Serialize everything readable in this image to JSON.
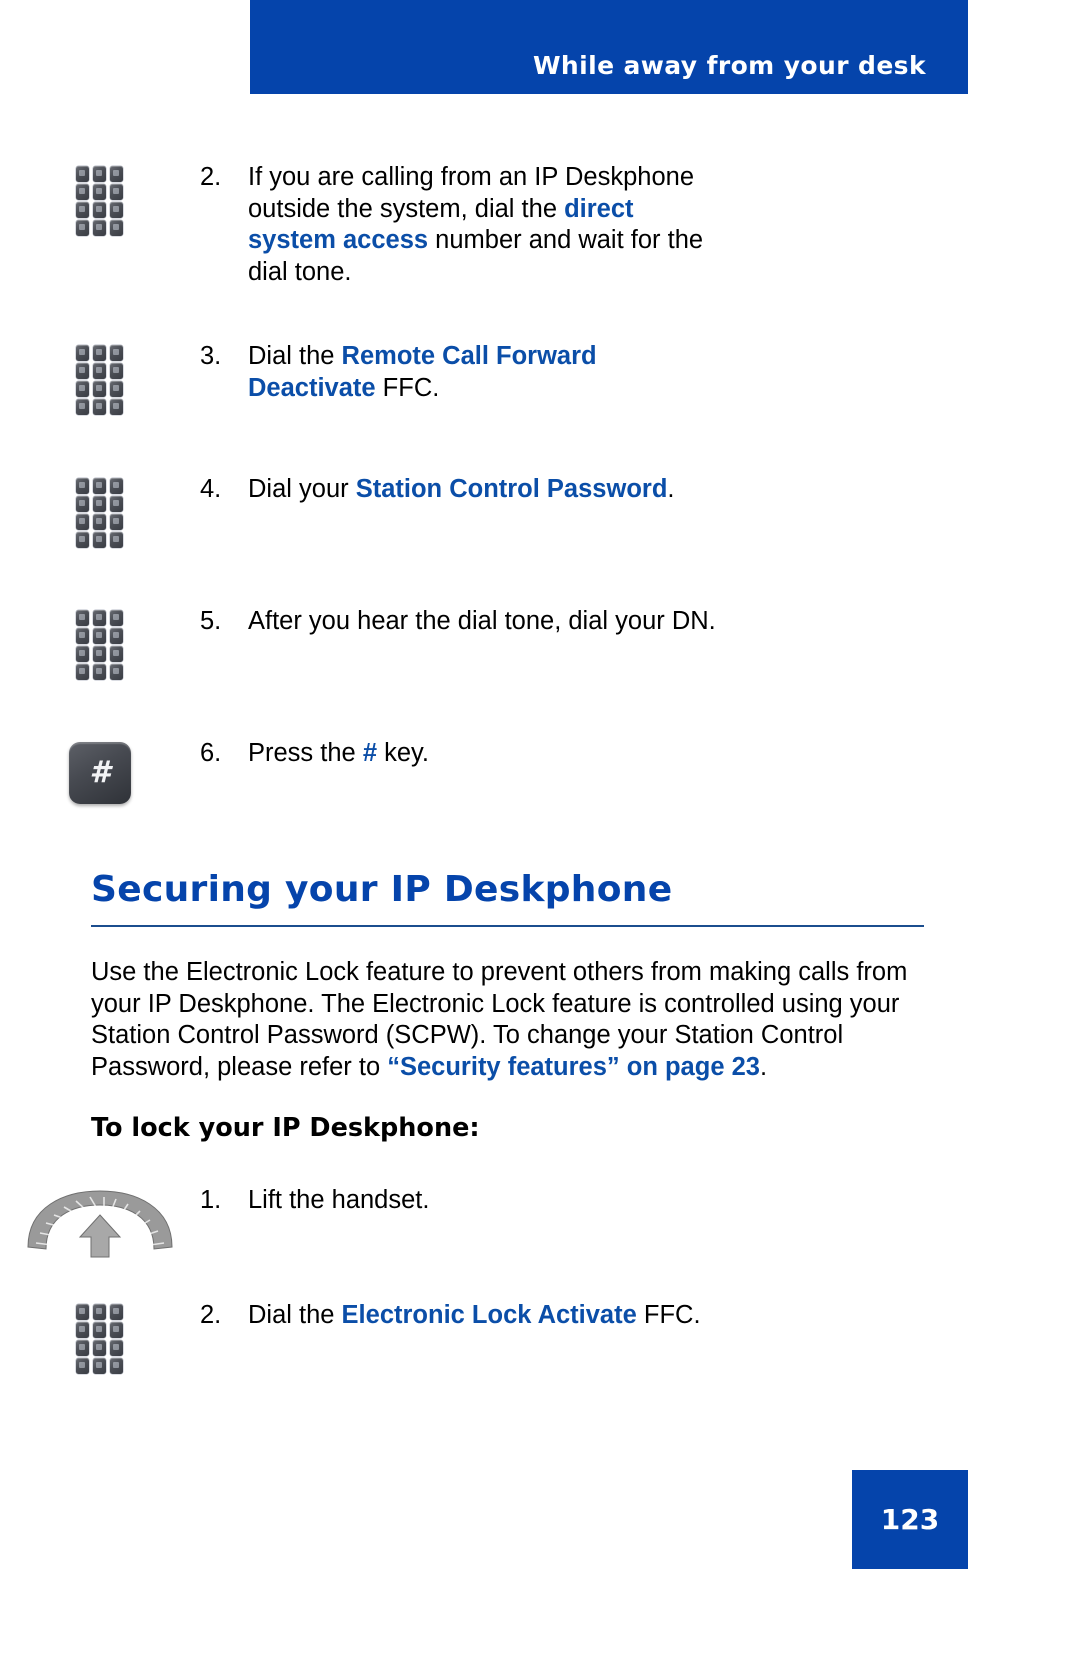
{
  "header": {
    "title": "While away from your desk",
    "banner_color": "#0544ab"
  },
  "steps_top": [
    {
      "number": "2.",
      "icon": "keypad-icon",
      "segments": [
        {
          "text": "If you are calling from an IP Deskphone outside the system, dial the ",
          "style": "normal"
        },
        {
          "text": "direct system access",
          "style": "highlight"
        },
        {
          "text": " number and wait for the dial tone.",
          "style": "normal"
        }
      ]
    },
    {
      "number": "3.",
      "icon": "keypad-icon",
      "segments": [
        {
          "text": "Dial the ",
          "style": "normal"
        },
        {
          "text": "Remote Call Forward Deactivate",
          "style": "highlight"
        },
        {
          "text": " FFC.",
          "style": "normal"
        }
      ]
    },
    {
      "number": "4.",
      "icon": "keypad-icon",
      "segments": [
        {
          "text": "Dial your ",
          "style": "normal"
        },
        {
          "text": "Station Control Password",
          "style": "highlight"
        },
        {
          "text": ".",
          "style": "normal"
        }
      ]
    },
    {
      "number": "5.",
      "icon": "keypad-icon",
      "segments": [
        {
          "text": "After you hear the dial tone, dial your DN.",
          "style": "normal"
        }
      ]
    },
    {
      "number": "6.",
      "icon": "hash-key-icon",
      "segments": [
        {
          "text": "Press the ",
          "style": "normal"
        },
        {
          "text": "#",
          "style": "highlight"
        },
        {
          "text": " key.",
          "style": "normal"
        }
      ]
    }
  ],
  "section": {
    "heading": "Securing your IP Deskphone",
    "heading_color": "#0544ab",
    "paragraph": [
      {
        "text": "Use the Electronic Lock feature to prevent others from making calls from your IP Deskphone. The Electronic Lock feature is controlled using your Station Control Password (SCPW). To change your Station Control Password, please refer to ",
        "style": "normal"
      },
      {
        "text": "“Security features” on page 23",
        "style": "highlight"
      },
      {
        "text": ".",
        "style": "normal"
      }
    ],
    "subheading": "To lock your IP Deskphone:"
  },
  "steps_bottom": [
    {
      "number": "1.",
      "icon": "handset-icon",
      "segments": [
        {
          "text": "Lift the handset.",
          "style": "normal"
        }
      ]
    },
    {
      "number": "2.",
      "icon": "keypad-icon",
      "segments": [
        {
          "text": "Dial the ",
          "style": "normal"
        },
        {
          "text": "Electronic Lock Activate",
          "style": "highlight"
        },
        {
          "text": " FFC.",
          "style": "normal"
        }
      ]
    }
  ],
  "footer": {
    "page_number": "123",
    "box_color": "#0544ab"
  },
  "colors": {
    "accent_blue": "#0544ab",
    "inline_highlight": "#0b4ea8",
    "rule": "#1b4d8e"
  }
}
